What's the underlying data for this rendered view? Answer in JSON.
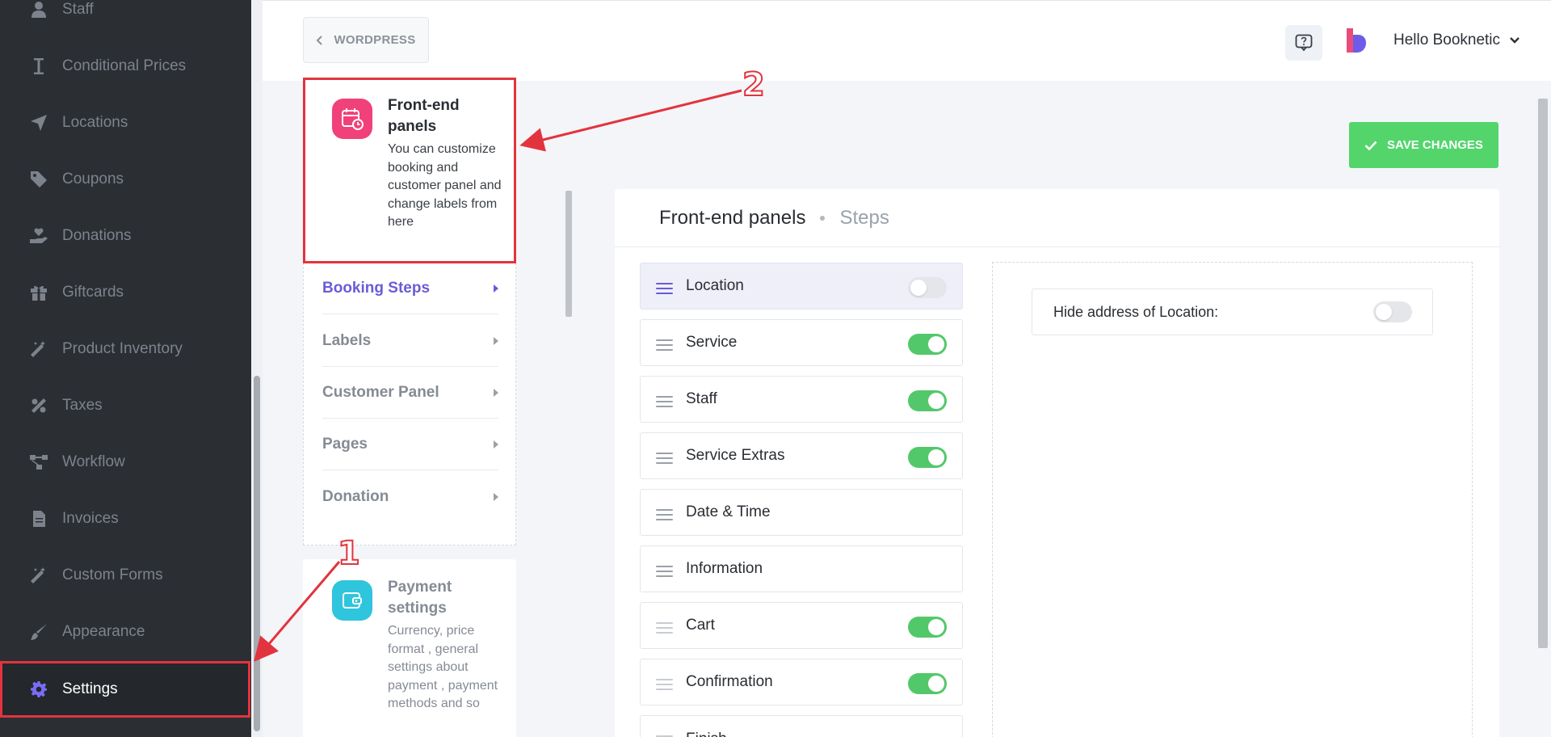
{
  "sidebar": {
    "items": [
      {
        "label": "Staff",
        "icon": "user-icon"
      },
      {
        "label": "Conditional Prices",
        "icon": "text-cursor-icon"
      },
      {
        "label": "Locations",
        "icon": "location-arrow-icon"
      },
      {
        "label": "Coupons",
        "icon": "tag-icon"
      },
      {
        "label": "Donations",
        "icon": "hand-holding-heart-icon"
      },
      {
        "label": "Giftcards",
        "icon": "gift-icon"
      },
      {
        "label": "Product Inventory",
        "icon": "magic-wand-icon"
      },
      {
        "label": "Taxes",
        "icon": "percent-icon"
      },
      {
        "label": "Workflow",
        "icon": "workflow-icon"
      },
      {
        "label": "Invoices",
        "icon": "file-icon"
      },
      {
        "label": "Custom Forms",
        "icon": "magic-wand-icon"
      },
      {
        "label": "Appearance",
        "icon": "paint-brush-icon"
      },
      {
        "label": "Settings",
        "icon": "gear-icon",
        "active": true
      }
    ]
  },
  "header": {
    "back_label": "WORDPRESS",
    "user_greeting": "Hello Booknetic"
  },
  "categories": {
    "frontend": {
      "title": "Front-end panels",
      "description": "You can customize booking and customer panel and change labels from here"
    },
    "submenu": [
      {
        "label": "Booking Steps",
        "active": true
      },
      {
        "label": "Labels"
      },
      {
        "label": "Customer Panel"
      },
      {
        "label": "Pages"
      },
      {
        "label": "Donation"
      }
    ],
    "payment": {
      "title": "Payment settings",
      "description": "Currency, price format , general settings about payment , payment methods and so"
    }
  },
  "main": {
    "save_label": "SAVE CHANGES",
    "panel_title": "Front-end panels",
    "panel_subtitle": "Steps",
    "steps": [
      {
        "label": "Location",
        "toggle": "off",
        "active": true
      },
      {
        "label": "Service",
        "toggle": "on"
      },
      {
        "label": "Staff",
        "toggle": "on"
      },
      {
        "label": "Service Extras",
        "toggle": "on"
      },
      {
        "label": "Date & Time",
        "toggle": "none"
      },
      {
        "label": "Information",
        "toggle": "none"
      },
      {
        "label": "Cart",
        "toggle": "on"
      },
      {
        "label": "Confirmation",
        "toggle": "on"
      },
      {
        "label": "Finish",
        "toggle": "none"
      }
    ],
    "option": {
      "label": "Hide address of Location:",
      "toggle": "off"
    }
  },
  "annotations": {
    "marker_1": "1",
    "marker_2": "2",
    "color": "#e2343e"
  },
  "colors": {
    "sidebar_bg": "#2b2e33",
    "accent": "#6a5bd9",
    "toggle_on": "#53c86a",
    "save_button": "#53d56c"
  }
}
